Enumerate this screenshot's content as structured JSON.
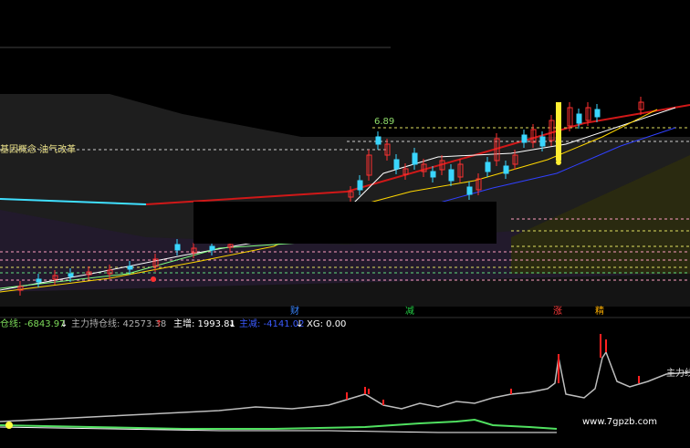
{
  "upper_panel": {
    "concept_label": "基因概念·油气改革",
    "high_price_label": "6.89",
    "event_markers": [
      {
        "label": "财",
        "color": "#3a86ff"
      },
      {
        "label": "减",
        "color": "#22cc44"
      },
      {
        "label": "涨",
        "color": "#ff3b3b"
      },
      {
        "label": "精",
        "color": "#ffb000"
      }
    ]
  },
  "indicator_bar": {
    "items": [
      {
        "label": "仓线: -6843.97",
        "arrow": "↓",
        "color": "#7ddc5a",
        "arrow_color": "#ffffff"
      },
      {
        "label": "主力持仓线: 42573.38",
        "arrow": "↑",
        "color": "#b0b0b0",
        "arrow_color": "#ff3030"
      },
      {
        "label": "主增: 1993.81",
        "arrow": "↓",
        "color": "#ffffff",
        "arrow_color": "#ffffff"
      },
      {
        "label": "主减: -4141.02",
        "arrow": "↓",
        "color": "#3b5bff",
        "arrow_color": "#ffffff"
      },
      {
        "label": "XG: 0.00",
        "arrow": "",
        "color": "#ffffff",
        "arrow_color": "#ffffff"
      }
    ]
  },
  "lower_panel": {
    "line_label": "主力线"
  },
  "watermark": "www.7gpzb.com",
  "colors": {
    "up": "#ff3030",
    "down": "#3ad6ff",
    "ma_white": "#ffffff",
    "ma_yellow": "#ffd700",
    "ma_red": "#ff2020",
    "ma_blue": "#3040ff",
    "grid_pink": "#ff9fbf",
    "grid_yellow": "#e0e060",
    "grid_green": "#60e080"
  }
}
